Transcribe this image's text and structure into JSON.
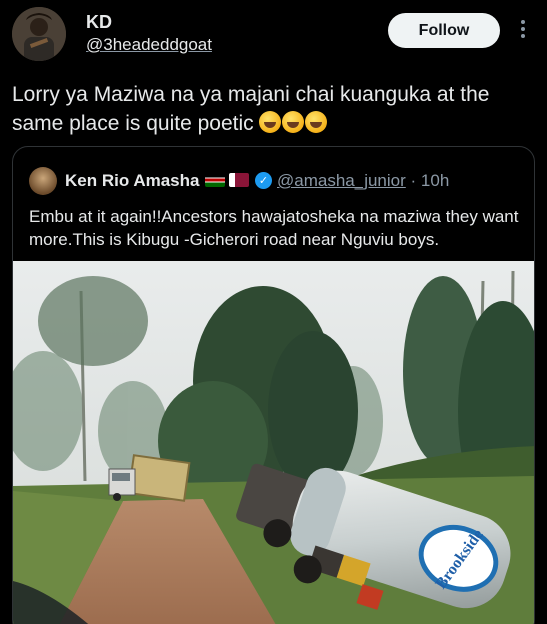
{
  "author": {
    "display_name": "KD",
    "handle": "@3headeddgoat",
    "follow_label": "Follow"
  },
  "tweet": {
    "text": "Lorry ya Maziwa na ya majani chai kuanguka at the same place is quite poetic",
    "emoji_count": 3
  },
  "quoted": {
    "display_name": "Ken Rio Amasha",
    "handle": "@amasha_junior",
    "time": "10h",
    "separator": "·",
    "verified": true,
    "flags": [
      "kenya-flag",
      "qatar-flag"
    ],
    "text": "Embu at it again!!Ancestors hawajatosheka na maziwa they want more.This is Kibugu -Gicherori road near Nguviu boys.",
    "media": {
      "description_icon": "photo",
      "tanker_brand": "Brookside"
    }
  },
  "colors": {
    "background": "#000000",
    "text": "#e7e9ea",
    "muted": "#8b98a5",
    "border": "#2f3336",
    "verified": "#1d9bf0",
    "follow_bg": "#eff3f4"
  }
}
